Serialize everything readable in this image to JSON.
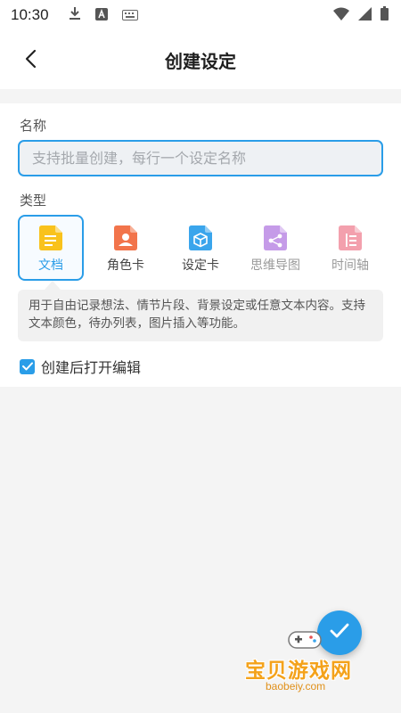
{
  "status_bar": {
    "time": "10:30",
    "icons_left": [
      "download-icon",
      "a-icon",
      "keyboard-icon"
    ],
    "icons_right": [
      "wifi-icon",
      "signal-icon",
      "battery-icon"
    ]
  },
  "header": {
    "title": "创建设定",
    "back_icon": "back-arrow-icon"
  },
  "form": {
    "name_label": "名称",
    "name_placeholder": "支持批量创建，每行一个设定名称",
    "name_value": "",
    "type_label": "类型",
    "types": [
      {
        "label": "文档",
        "icon": "document-icon",
        "color": "#f9c21c",
        "selected": true
      },
      {
        "label": "角色卡",
        "icon": "character-card-icon",
        "color": "#f2744b",
        "selected": false
      },
      {
        "label": "设定卡",
        "icon": "setting-card-icon",
        "color": "#3aa5ec",
        "selected": false
      },
      {
        "label": "思维导图",
        "icon": "mind-map-icon",
        "color": "#c59be8",
        "selected": false
      },
      {
        "label": "时间轴",
        "icon": "timeline-icon",
        "color": "#f3a0ad",
        "selected": false
      }
    ],
    "description": "用于自由记录想法、情节片段、背景设定或任意文本内容。支持文本颜色，待办列表，图片插入等功能。",
    "open_after_create_label": "创建后打开编辑",
    "open_after_create_checked": true
  },
  "fab": {
    "icon": "check-icon"
  },
  "watermark": {
    "title": "宝贝游戏网",
    "url": "baobeiy.com"
  },
  "colors": {
    "accent": "#2a9de8",
    "background": "#f4f4f4"
  }
}
